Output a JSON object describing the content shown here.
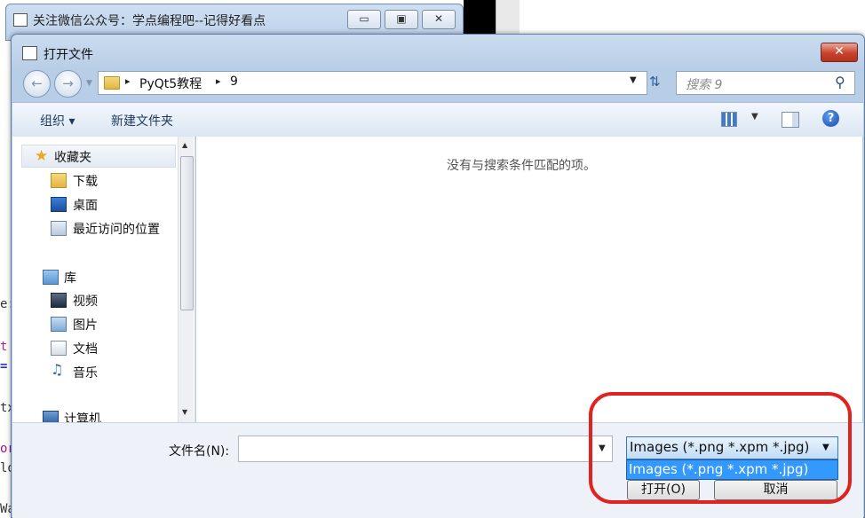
{
  "background_window": {
    "title": "关注微信公众号：学点编程吧--记得好看点",
    "minimize_glyph": "▭",
    "maximize_glyph": "▣",
    "close_glyph": "✕"
  },
  "code_fragments": [
    "t",
    "=",
    "tx",
    "or",
    "lo",
    "Wa",
    "e:"
  ],
  "dialog": {
    "title": "打开文件",
    "close_glyph": "✕",
    "back_glyph": "←",
    "forward_glyph": "→",
    "address": {
      "crumbs": [
        "PyQt5教程",
        "9"
      ],
      "separator": "▸"
    },
    "search_placeholder": "搜索 9",
    "toolbar": {
      "organize": "组织 ▾",
      "new_folder": "新建文件夹",
      "help": "?"
    },
    "nav": {
      "favorites": "收藏夹",
      "downloads": "下载",
      "desktop": "桌面",
      "recent": "最近访问的位置",
      "libraries": "库",
      "videos": "视频",
      "pictures": "图片",
      "documents": "文档",
      "music": "音乐",
      "computer": "计算机"
    },
    "empty_message": "没有与搜索条件匹配的项。",
    "filename_label": "文件名(N):",
    "filename_value": "",
    "filter_selected": "Images (*.png *.xpm *.jpg)",
    "filter_options": [
      "Images (*.png *.xpm *.jpg)"
    ],
    "open_button": "打开(O)",
    "cancel_button": "取消"
  },
  "colors": {
    "selection": "#3399ff",
    "highlight_circle": "#e0231f"
  }
}
